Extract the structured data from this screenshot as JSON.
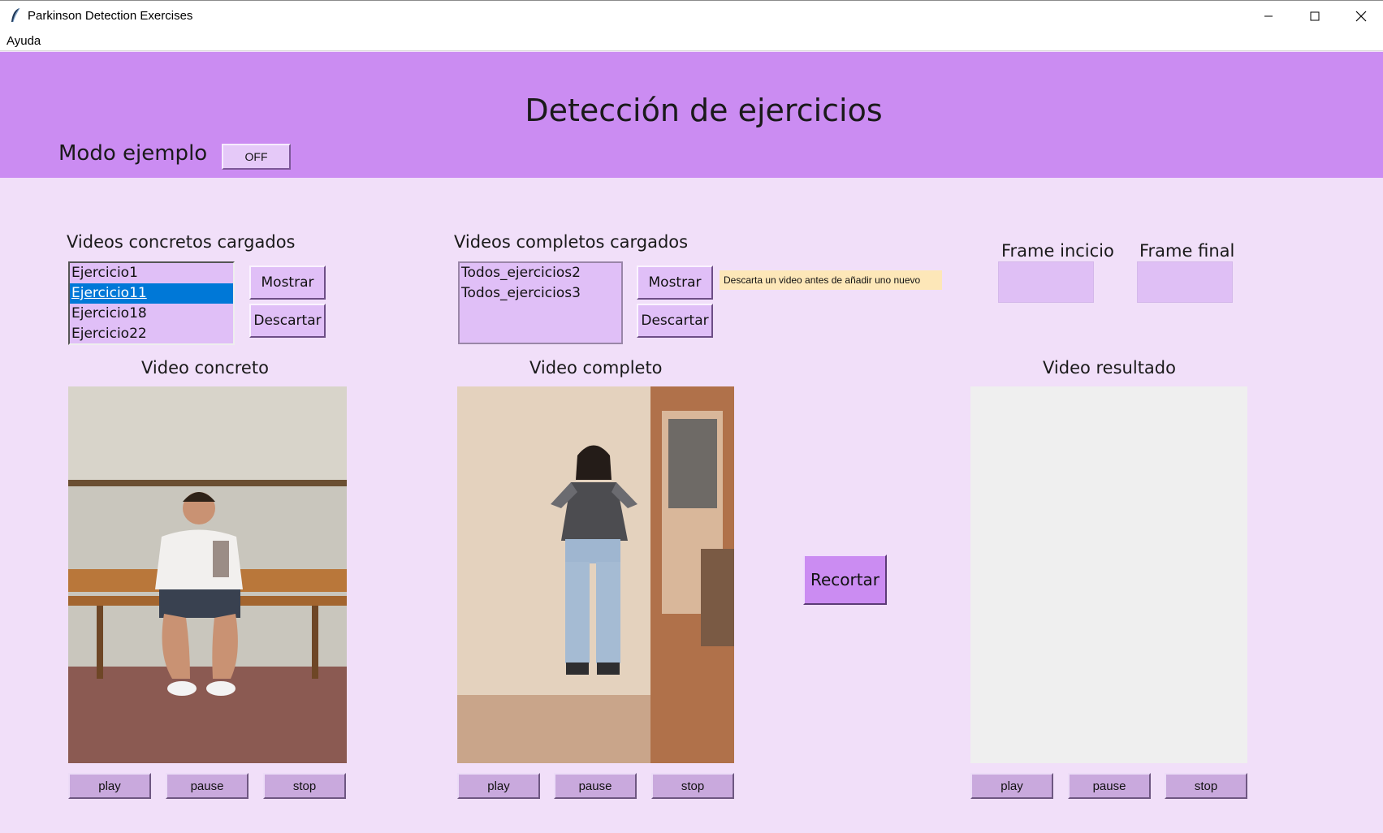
{
  "window": {
    "title": "Parkinson Detection Exercises",
    "controls": [
      "minimize-icon",
      "maximize-icon",
      "close-icon"
    ]
  },
  "menu": {
    "items": [
      "Ayuda"
    ]
  },
  "header": {
    "title": "Detección de ejercicios",
    "mode_label": "Modo ejemplo",
    "mode_toggle": "OFF"
  },
  "concrete_list": {
    "label": "Videos concretos cargados",
    "items": [
      "Ejercicio1",
      "Ejercicio11",
      "Ejercicio18",
      "Ejercicio22"
    ],
    "selected": "Ejercicio11",
    "show_button": "Mostrar",
    "discard_button": "Descartar"
  },
  "complete_list": {
    "label": "Videos completos cargados",
    "items": [
      "Todos_ejercicios2",
      "Todos_ejercicios3"
    ],
    "show_button": "Mostrar",
    "discard_button": "Descartar",
    "tooltip": "Descarta un video antes de añadir uno nuevo"
  },
  "frames": {
    "start_label": "Frame incicio",
    "end_label": "Frame final",
    "start_value": "",
    "end_value": ""
  },
  "videos": {
    "concrete_title": "Video concreto",
    "complete_title": "Video completo",
    "result_title": "Video resultado"
  },
  "controls": {
    "play": "play",
    "pause": "pause",
    "stop": "stop"
  },
  "cut_button": "Recortar",
  "colors": {
    "header": "#cb8cf2",
    "background": "#f1dff9",
    "list_bg": "#e0bff7",
    "selection": "#0078d7",
    "control_button": "#c9a9dd",
    "tooltip": "#fde7b8"
  }
}
